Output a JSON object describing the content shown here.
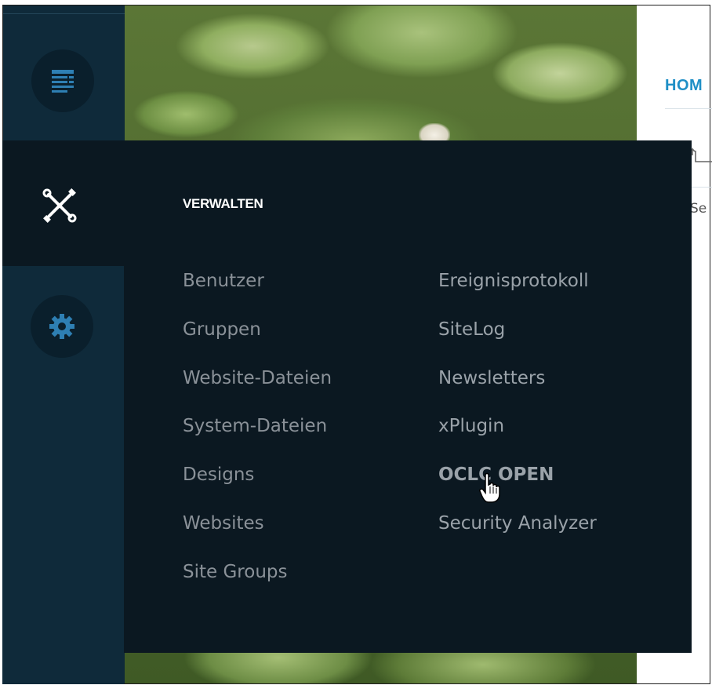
{
  "header": {
    "home_label": "HOM",
    "se_text": "Se"
  },
  "rail": {
    "pages_icon": "page-lines-icon",
    "settings_icon": "gear-icon",
    "tools_icon": "wrench-screwdriver-icon"
  },
  "menu": {
    "heading": "VERWALTEN",
    "col1": [
      {
        "label": "Benutzer"
      },
      {
        "label": "Gruppen"
      },
      {
        "label": "Website-Dateien"
      },
      {
        "label": "System-Dateien"
      },
      {
        "label": "Designs"
      },
      {
        "label": "Websites"
      },
      {
        "label": "Site Groups"
      }
    ],
    "col2": [
      {
        "label": "Ereignisprotokoll"
      },
      {
        "label": "SiteLog"
      },
      {
        "label": "Newsletters"
      },
      {
        "label": "xPlugin"
      },
      {
        "label": "OCLC OPEN",
        "hovered": true
      },
      {
        "label": "Security Analyzer"
      }
    ]
  },
  "colors": {
    "rail": "#0f2a3a",
    "panel": "#0b1821",
    "accent": "#1f8fc6",
    "icon_blue": "#2e7fb3"
  }
}
